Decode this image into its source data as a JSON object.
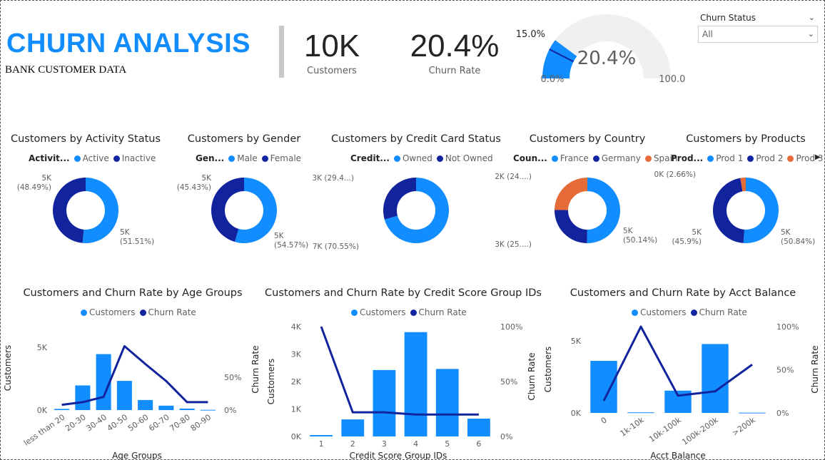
{
  "header": {
    "title": "CHURN ANALYSIS",
    "subtitle": "BANK CUSTOMER DATA"
  },
  "kpis": [
    {
      "value": "10K",
      "label": "Customers"
    },
    {
      "value": "20.4%",
      "label": "Churn Rate"
    }
  ],
  "gauge": {
    "value": 20.4,
    "value_label": "20.4%",
    "target": 15.0,
    "target_label": "15.0%",
    "min_label": "0.0%",
    "max_label": "100.0%"
  },
  "slicer": {
    "title": "Churn Status",
    "value": "All"
  },
  "colors": {
    "light": "#118DFF",
    "dark": "#12239E",
    "orange": "#E66C37",
    "title": "#118DFF",
    "track": "#F0F0F0"
  },
  "icons": {
    "dropdown": "chevron-down-icon",
    "more": "right-arrow-icon"
  },
  "chart_data": [
    {
      "type": "pie",
      "title": "Customers by Activity Status",
      "legend_title": "Activit...",
      "labels": [
        "Active",
        "Inactive"
      ],
      "values": [
        51.51,
        48.49
      ],
      "data_labels": [
        [
          "5K",
          "(51.51%)"
        ],
        [
          "5K",
          "(48.49%)"
        ]
      ]
    },
    {
      "type": "pie",
      "title": "Customers by Gender",
      "legend_title": "Gen...",
      "labels": [
        "Male",
        "Female"
      ],
      "values": [
        54.57,
        45.43
      ],
      "data_labels": [
        [
          "5K",
          "(54.57%)"
        ],
        [
          "5K",
          "(45.43%)"
        ]
      ]
    },
    {
      "type": "pie",
      "title": "Customers by Credit Card Status",
      "legend_title": "Credit...",
      "labels": [
        "Owned",
        "Not Owned"
      ],
      "values": [
        70.55,
        29.45
      ],
      "data_labels": [
        [
          "7K (70.55%)"
        ],
        [
          "3K (29.4...)"
        ]
      ]
    },
    {
      "type": "pie",
      "title": "Customers by Country",
      "legend_title": "Coun...",
      "labels": [
        "France",
        "Germany",
        "Spain"
      ],
      "values": [
        50.14,
        25.09,
        24.77
      ],
      "data_labels": [
        [
          "5K",
          "(50.14%)"
        ],
        [
          "3K (25....)"
        ],
        [
          "2K (24....)"
        ]
      ]
    },
    {
      "type": "pie",
      "title": "Customers by Products",
      "legend_title": "Prod...",
      "labels": [
        "Prod 1",
        "Prod 2",
        "Prod 3"
      ],
      "values": [
        50.84,
        45.9,
        2.66
      ],
      "data_labels": [
        [
          "5K",
          "(50.84%)"
        ],
        [
          "5K",
          "(45.9%)"
        ],
        [
          "0K (2.66%)"
        ]
      ]
    },
    {
      "type": "bar",
      "title": "Customers and Churn Rate by Age Groups",
      "xlabel": "Age Groups",
      "ylabel": "Customers",
      "categories": [
        "less than 20",
        "20-30",
        "30-40",
        "40-50",
        "50-60",
        "60-70",
        "70-80",
        "80-90"
      ],
      "series": [
        {
          "name": "Customers",
          "values": [
            90,
            1960,
            4450,
            2320,
            800,
            350,
            120,
            20
          ]
        },
        {
          "name": "Churn Rate",
          "values": [
            0.08,
            0.12,
            0.2,
            0.97,
            0.7,
            0.44,
            0.12,
            0.12
          ]
        }
      ],
      "y_ticks": [
        "0K",
        "5K"
      ],
      "y2_ticks": [
        "0%",
        "50%"
      ],
      "ylim": [
        0,
        5500
      ],
      "y2lim": [
        0,
        1.05
      ]
    },
    {
      "type": "bar",
      "title": "Customers and Churn Rate by Credit Score Group IDs",
      "xlabel": "Credit Score Group IDs",
      "ylabel": "Customers",
      "y2label": "Churn Rate",
      "categories": [
        "1",
        "2",
        "3",
        "4",
        "5",
        "6"
      ],
      "series": [
        {
          "name": "Customers",
          "values": [
            50,
            620,
            2420,
            3800,
            2460,
            650
          ]
        },
        {
          "name": "Churn Rate",
          "values": [
            1.0,
            0.22,
            0.22,
            0.2,
            0.2,
            0.2
          ]
        }
      ],
      "y_ticks": [
        "0K",
        "1K",
        "2K",
        "3K",
        "4K"
      ],
      "y2_ticks": [
        "0%",
        "50%",
        "100%"
      ],
      "ylim": [
        0,
        4000
      ],
      "y2lim": [
        0,
        1.0
      ]
    },
    {
      "type": "bar",
      "title": "Customers and Churn Rate by Acct Balance",
      "xlabel": "Acct Balance",
      "ylabel": "Customers",
      "y2label": "Churn Rate",
      "categories": [
        "0",
        "1k-10k",
        "10k-100k",
        "100k-200k",
        ">200k"
      ],
      "series": [
        {
          "name": "Customers",
          "values": [
            3620,
            40,
            1550,
            4790,
            20
          ]
        },
        {
          "name": "Churn Rate",
          "values": [
            0.14,
            1.0,
            0.2,
            0.25,
            0.56
          ]
        }
      ],
      "y_ticks": [
        "0K",
        "5K"
      ],
      "y2_ticks": [
        "0%",
        "50%",
        "100%"
      ],
      "ylim": [
        0,
        6000
      ],
      "y2lim": [
        0,
        1.0
      ]
    }
  ]
}
